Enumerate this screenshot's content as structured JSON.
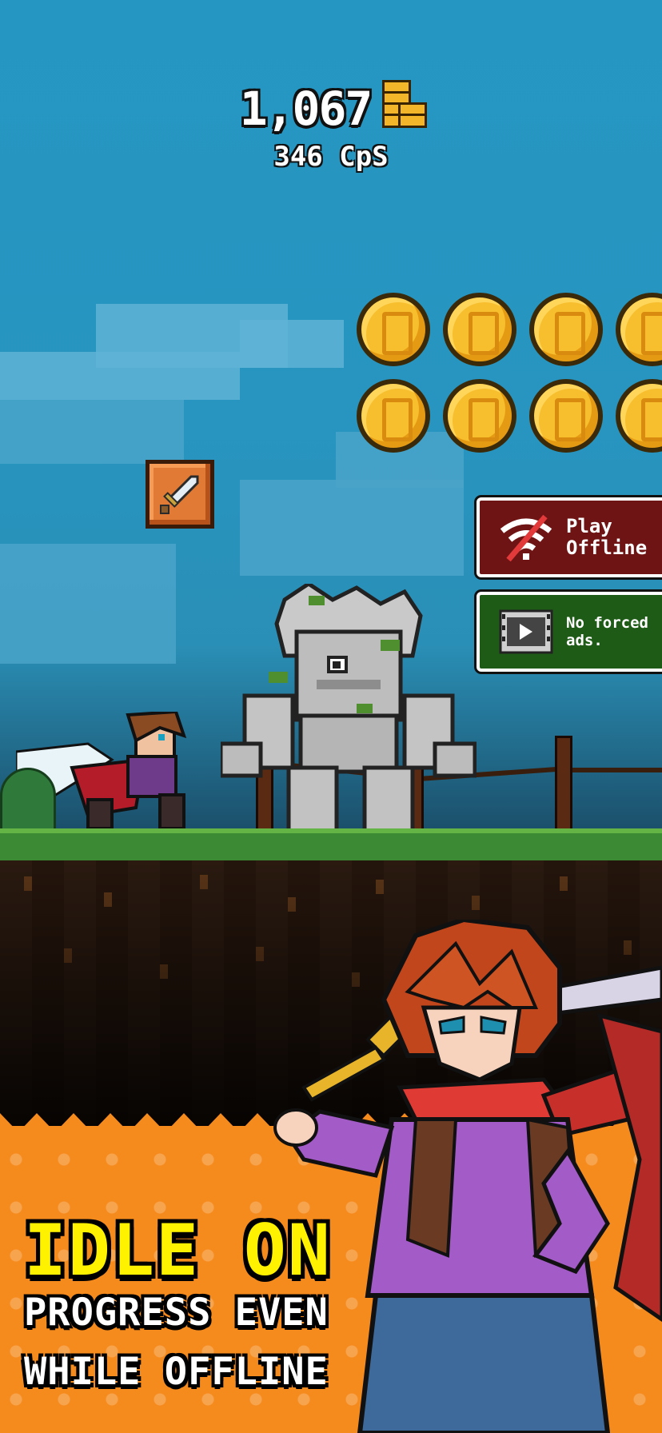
{
  "hud": {
    "gold_amount": "1,067",
    "gold_icon": "gold-coin-stack-icon",
    "cps": "346 CpS"
  },
  "coins": {
    "rows": 2,
    "per_row": 4,
    "icon": "gold-coin-icon"
  },
  "powerup": {
    "icon": "sword-icon"
  },
  "features": [
    {
      "icon": "no-wifi-icon",
      "label_line1": "Play",
      "label_line2": "Offline"
    },
    {
      "icon": "film-ad-icon",
      "label_line1": "No forced",
      "label_line2": "ads."
    }
  ],
  "promo": {
    "headline": "IDLE ON",
    "subline_1": "PROGRESS EVEN",
    "subline_2": "WHILE OFFLINE"
  },
  "colors": {
    "sky": "#2596c2",
    "coin": "#f7be2d",
    "offline_card": "#6e1414",
    "ads_card": "#1e5b16",
    "banner": "#f58a1d",
    "headline": "#fff200"
  }
}
